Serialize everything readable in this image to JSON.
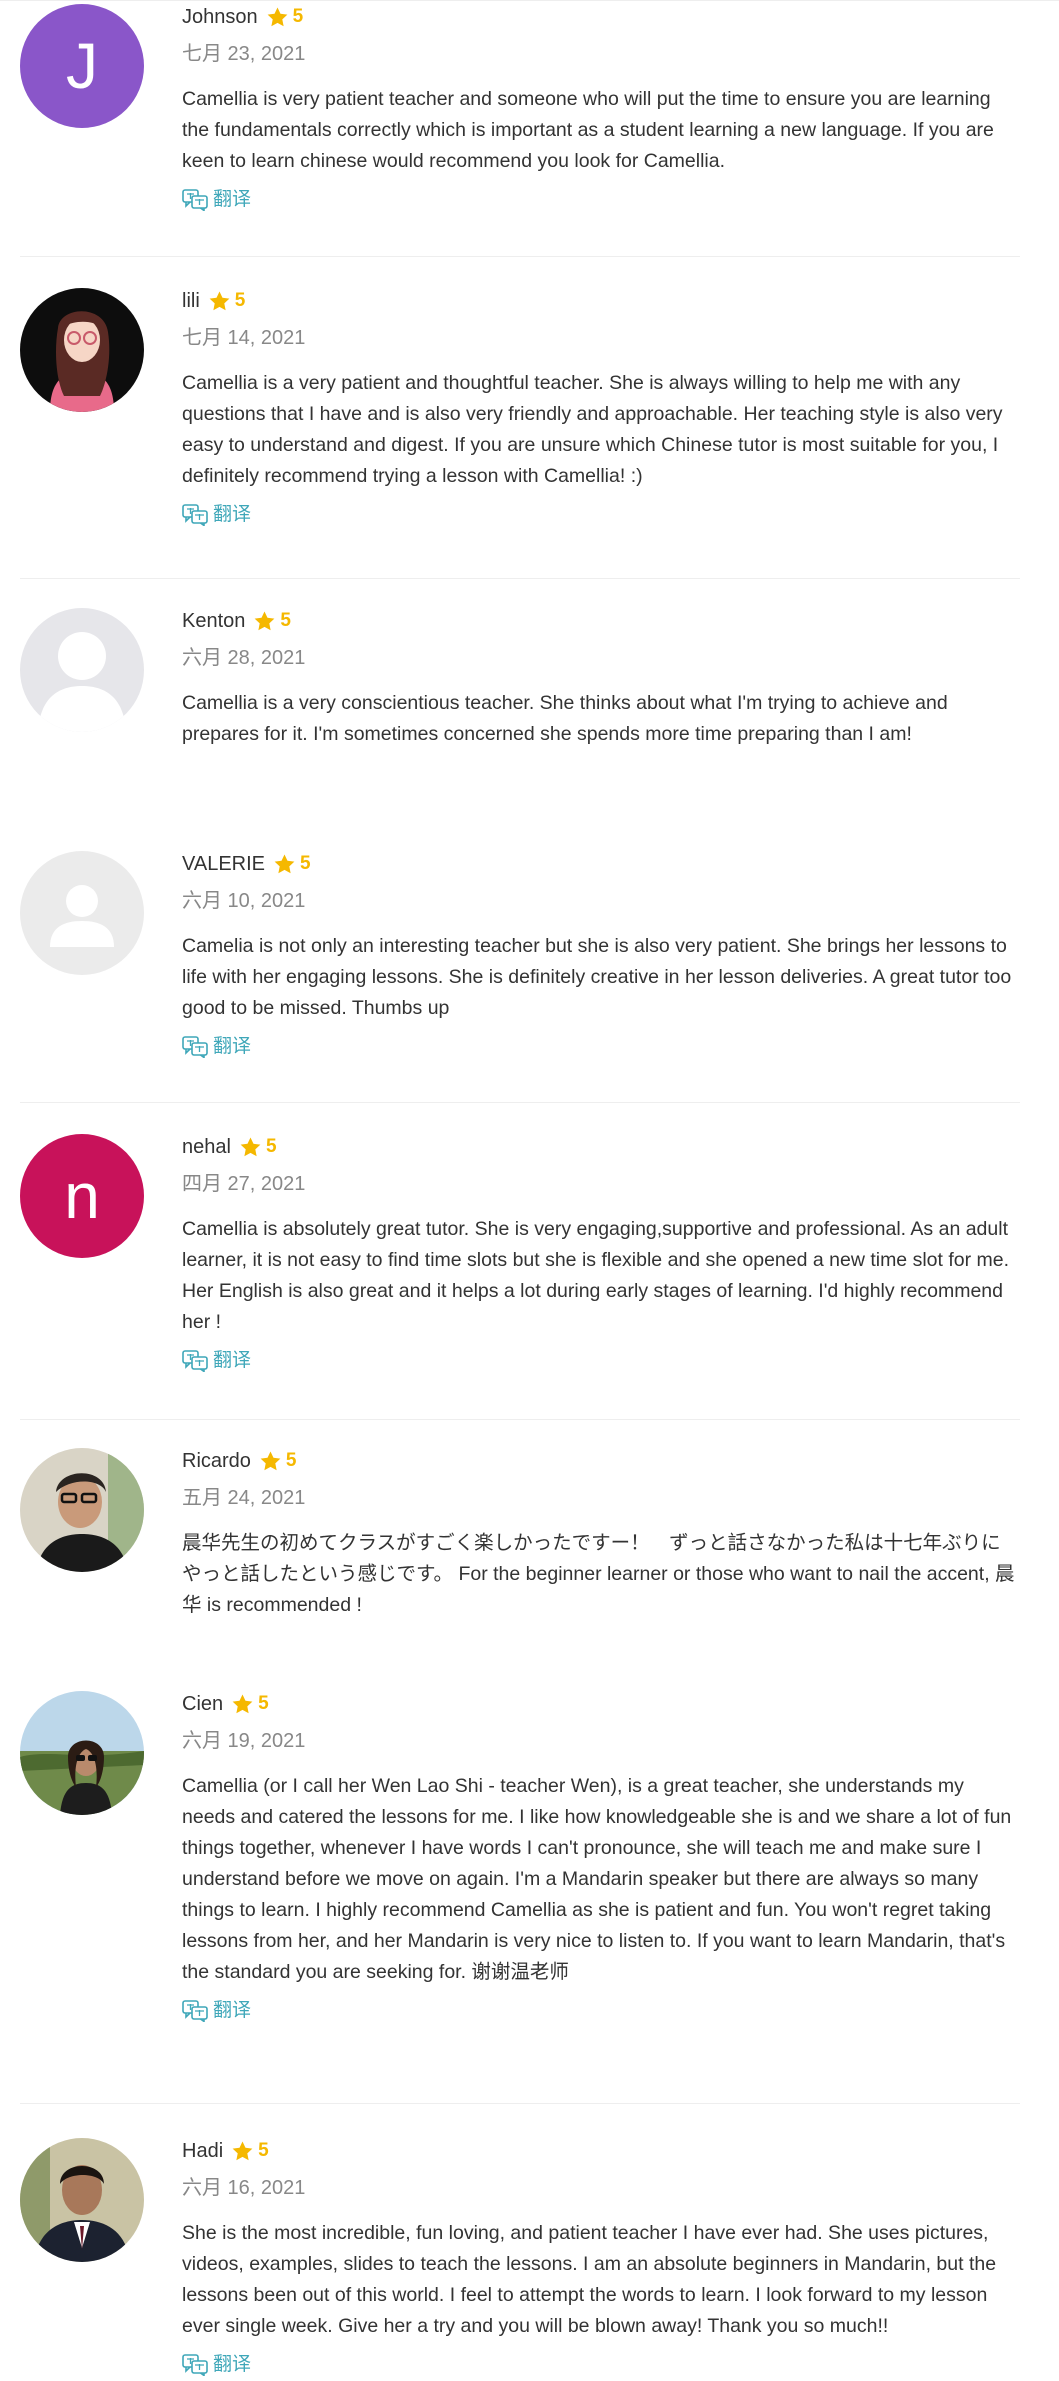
{
  "translate_label": "翻译",
  "accent_color": "#3fa7b9",
  "star_color": "#f5b800",
  "reviews": [
    {
      "name": "Johnson",
      "rating": "5",
      "date": "七月 23, 2021",
      "text": "Camellia is very patient teacher and someone who will put the time to ensure you are learning the fundamentals correctly which is important as a student learning a new language. If you are keen to learn chinese would recommend you look for Camellia.",
      "avatar_letter": "J",
      "avatar_color": "#8a56c9"
    },
    {
      "name": "lili",
      "rating": "5",
      "date": "七月 14, 2021",
      "text": "Camellia is a very patient and thoughtful teacher. She is always willing to help me with any questions that I have and is also very friendly and approachable. Her teaching style is also very easy to understand and digest. If you are unsure which Chinese tutor is most suitable for you, I definitely recommend trying a lesson with Camellia! :)"
    },
    {
      "name": "Kenton",
      "rating": "5",
      "date": "六月 28, 2021",
      "text": "Camellia is a very conscientious teacher. She thinks about what I'm trying to achieve and prepares for it. I'm sometimes concerned she spends more time preparing than I am!"
    },
    {
      "name": "VALERIE",
      "rating": "5",
      "date": "六月 10, 2021",
      "text": "Camelia is not only an interesting teacher but she is also very patient. She brings her lessons to life with her engaging lessons. She is definitely creative in her lesson deliveries. A great tutor too good to be missed. Thumbs up"
    },
    {
      "name": "nehal",
      "rating": "5",
      "date": "四月 27, 2021",
      "text": "Camellia is absolutely great tutor. She is very engaging,supportive and professional. As an adult learner, it is not easy to find time slots but she is flexible and she opened a new time slot for me. Her English is also great and it helps a lot during early stages of learning. I'd highly recommend her !",
      "avatar_letter": "n",
      "avatar_color": "#c8125a"
    },
    {
      "name": "Ricardo",
      "rating": "5",
      "date": "五月 24, 2021",
      "text": "晨华先生の初めてクラスがすごく楽しかったですー！　ずっと話さなかった私は十七年ぶりにやっと話したという感じです。 For the beginner learner or those who want to nail the accent, 晨华 is recommended !"
    },
    {
      "name": "Cien",
      "rating": "5",
      "date": "六月 19, 2021",
      "text": "Camellia (or I call her Wen Lao Shi - teacher Wen), is a great teacher, she understands my needs and catered the lessons for me. I like how knowledgeable she is and we share a lot of fun things together, whenever I have words I can't pronounce, she will teach me and make sure I understand before we move on again. I'm a Mandarin speaker but there are always so many things to learn. I highly recommend Camellia as she is patient and fun. You won't regret taking lessons from her, and her Mandarin is very nice to listen to. If you want to learn Mandarin, that's the standard you are seeking for. 谢谢温老师"
    },
    {
      "name": "Hadi",
      "rating": "5",
      "date": "六月 16, 2021",
      "text": "She is the most incredible, fun loving, and patient teacher I have ever had. She uses pictures, videos, examples, slides to teach the lessons. I am an absolute beginners in Mandarin, but the lessons been out of this world. I feel to attempt the words to learn. I look forward to my lesson ever single week. Give her a try and you will be blown away! Thank you so much!!"
    }
  ]
}
